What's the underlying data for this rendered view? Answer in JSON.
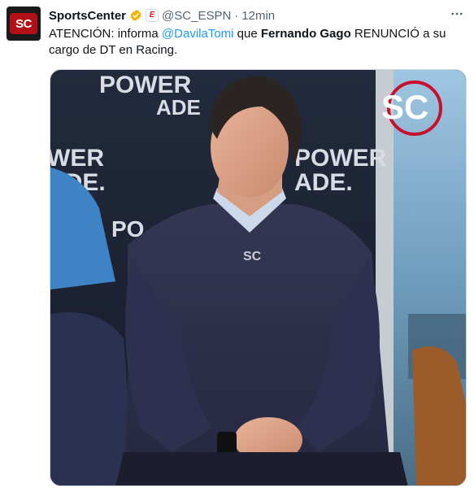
{
  "account": {
    "avatar_text": "SC",
    "name": "SportsCenter",
    "handle": "@SC_ESPN",
    "separator": "·",
    "time": "12min",
    "affiliate_badge": "E"
  },
  "menu": {
    "more_icon": "more-horizontal-icon"
  },
  "tweet": {
    "part1": "ATENCIÓN: informa ",
    "mention": "@DavilaTomi",
    "part2": " que ",
    "bold_name": "Fernando Gago",
    "part3": " RENUNCIÓ a su cargo de DT en Racing."
  },
  "media": {
    "backdrop_words": [
      "POWER",
      "ADE",
      "WER",
      "ADE.",
      "POWER",
      "ADE.",
      "PO"
    ],
    "watermark": "SC",
    "sweater_logo": "SC"
  },
  "colors": {
    "accent_link": "#1d9bf0",
    "brand_red": "#b11116",
    "verified": "#f4b400"
  }
}
